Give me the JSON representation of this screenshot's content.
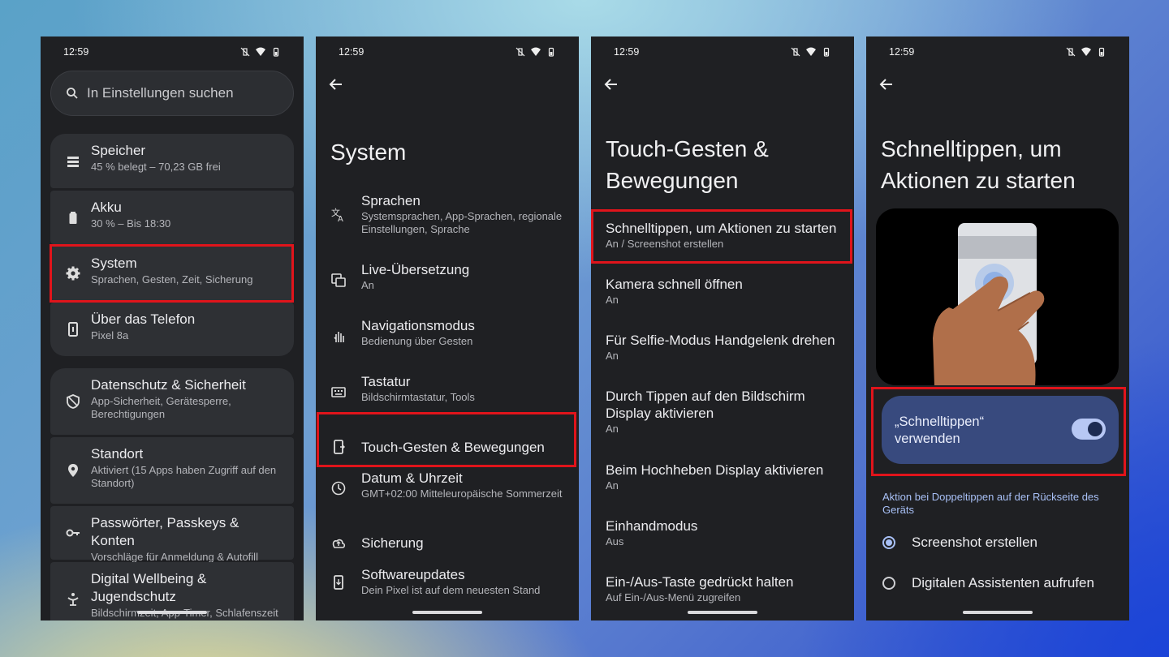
{
  "status_time": "12:59",
  "colors": {
    "highlight": "#e0141b",
    "accent": "#a8c0f6",
    "toggle_card": "#384a7e"
  },
  "phone1": {
    "search_placeholder": "In Einstellungen suchen",
    "items": [
      {
        "title": "Speicher",
        "subtitle": "45 % belegt – 70,23 GB frei",
        "icon": "storage-icon"
      },
      {
        "title": "Akku",
        "subtitle": "30 % – Bis 18:30",
        "icon": "battery-icon"
      },
      {
        "title": "System",
        "subtitle": "Sprachen, Gesten, Zeit, Sicherung",
        "icon": "gear-icon"
      },
      {
        "title": "Über das Telefon",
        "subtitle": "Pixel 8a",
        "icon": "phone-info-icon"
      },
      {
        "title": "Datenschutz & Sicherheit",
        "subtitle": "App-Sicherheit, Gerätesperre, Berechtigungen",
        "icon": "shield-icon"
      },
      {
        "title": "Standort",
        "subtitle": "Aktiviert (15 Apps haben Zugriff auf den Standort)",
        "icon": "location-icon"
      },
      {
        "title": "Passwörter, Passkeys & Konten",
        "subtitle": "Vorschläge für Anmeldung & Autofill",
        "icon": "key-icon"
      },
      {
        "title": "Digital Wellbeing & Jugendschutz",
        "subtitle": "Bildschirmzeit, App-Timer, Schlafenszeit",
        "icon": "wellbeing-icon"
      }
    ]
  },
  "phone2": {
    "title": "System",
    "items": [
      {
        "title": "Sprachen",
        "subtitle": "Systemsprachen, App-Sprachen, regionale Einstellungen, Sprache",
        "icon": "translate-icon"
      },
      {
        "title": "Live-Übersetzung",
        "subtitle": "An",
        "icon": "live-translate-icon"
      },
      {
        "title": "Navigationsmodus",
        "subtitle": "Bedienung über Gesten",
        "icon": "gesture-hand-icon"
      },
      {
        "title": "Tastatur",
        "subtitle": "Bildschirmtastatur, Tools",
        "icon": "keyboard-icon"
      },
      {
        "title": "Touch-Gesten & Bewegungen",
        "subtitle": "",
        "icon": "phone-gesture-icon"
      },
      {
        "title": "Datum & Uhrzeit",
        "subtitle": "GMT+02:00 Mitteleuropäische Sommerzeit",
        "icon": "clock-icon"
      },
      {
        "title": "Sicherung",
        "subtitle": "",
        "icon": "cloud-backup-icon"
      },
      {
        "title": "Softwareupdates",
        "subtitle": "Dein Pixel ist auf dem neuesten Stand",
        "icon": "system-update-icon"
      }
    ]
  },
  "phone3": {
    "title_line1": "Touch-Gesten &",
    "title_line2": "Bewegungen",
    "items": [
      {
        "title": "Schnelltippen, um Aktionen zu starten",
        "subtitle": "An / Screenshot erstellen"
      },
      {
        "title": "Kamera schnell öffnen",
        "subtitle": "An"
      },
      {
        "title": "Für Selfie-Modus Handgelenk drehen",
        "subtitle": "An"
      },
      {
        "title": "Durch Tippen auf den Bildschirm Display aktivieren",
        "subtitle": "An"
      },
      {
        "title": "Beim Hochheben Display aktivieren",
        "subtitle": "An"
      },
      {
        "title": "Einhandmodus",
        "subtitle": "Aus"
      },
      {
        "title": "Ein-/Aus-Taste gedrückt halten",
        "subtitle": "Auf Ein-/Aus-Menü zugreifen"
      }
    ]
  },
  "phone4": {
    "title_line1": "Schnelltippen, um",
    "title_line2": "Aktionen zu starten",
    "toggle_label_line1": "„Schnelltippen“",
    "toggle_label_line2": "verwenden",
    "toggle_on": true,
    "section_header": "Aktion bei Doppeltippen auf der Rückseite des Geräts",
    "options": [
      {
        "label": "Screenshot erstellen",
        "selected": true
      },
      {
        "label": "Digitalen Assistenten aufrufen",
        "selected": false
      }
    ]
  }
}
